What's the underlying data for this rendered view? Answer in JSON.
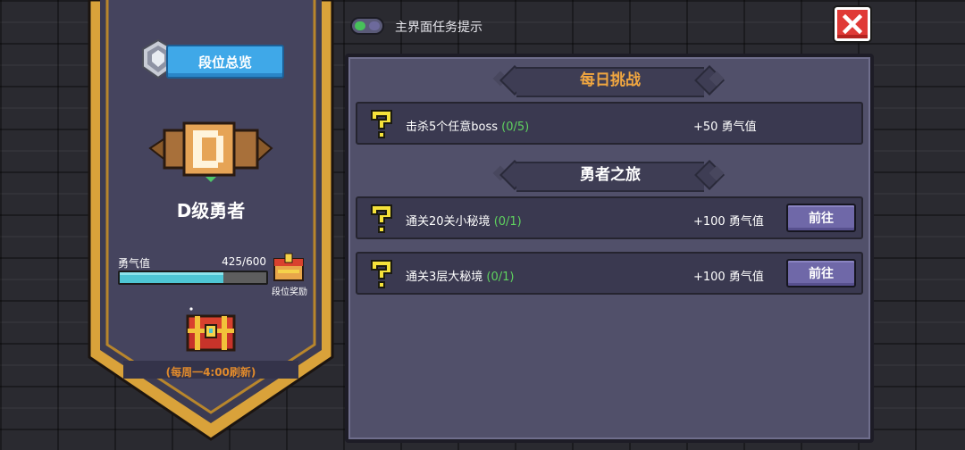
{
  "banner": {
    "rank_overview_label": "段位总览",
    "rank_title": "D级勇者",
    "courage_label": "勇气值",
    "courage_count": "425/600",
    "courage_progress": 0.708,
    "reward_label": "段位奖励",
    "refresh_note": "(每周一4:00刷新)"
  },
  "top": {
    "toggle_label": "主界面任务提示",
    "toggle_on": true
  },
  "sections": {
    "daily": {
      "title": "每日挑战",
      "tasks": [
        {
          "text": "击杀5个任意boss",
          "progress": "(0/5)",
          "reward": "+50 勇气值"
        }
      ]
    },
    "journey": {
      "title": "勇者之旅",
      "tasks": [
        {
          "text": "通关20关小秘境",
          "progress": "(0/1)",
          "reward": "+100 勇气值",
          "button": "前往"
        },
        {
          "text": "通关3层大秘境",
          "progress": "(0/1)",
          "reward": "+100 勇气值",
          "button": "前往"
        }
      ]
    }
  },
  "colors": {
    "banner_gold": "#d9a23a",
    "daily_title": "#f0a640",
    "progress_green": "#5fd35f",
    "close_red": "#e03a36",
    "button_purple": "#6f68a8"
  },
  "icons": [
    "medal-icon",
    "rank-emblem-icon",
    "reward-chest-icon",
    "treasure-chest-icon",
    "question-mark-icon",
    "close-icon"
  ]
}
